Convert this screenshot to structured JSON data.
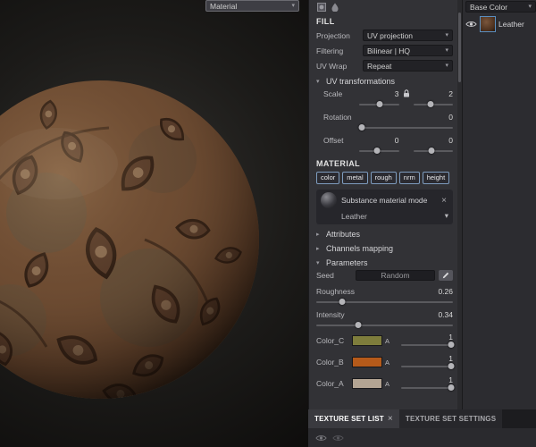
{
  "viewport": {
    "display_mode": "Material"
  },
  "icons": {
    "chevron_down": "▾",
    "chevron_right": "▸",
    "close": "×"
  },
  "fill": {
    "title": "FILL",
    "rows": [
      {
        "label": "Projection",
        "value": "UV projection"
      },
      {
        "label": "Filtering",
        "value": "Bilinear | HQ"
      },
      {
        "label": "UV Wrap",
        "value": "Repeat"
      }
    ],
    "uv": {
      "title": "UV transformations",
      "scale_label": "Scale",
      "scale_x": "3",
      "scale_y": "2",
      "rotation_label": "Rotation",
      "rotation_value": "0",
      "offset_label": "Offset",
      "offset_x": "0",
      "offset_y": "0"
    }
  },
  "material": {
    "title": "MATERIAL",
    "channels": [
      "color",
      "metal",
      "rough",
      "nrm",
      "height"
    ],
    "mode_label": "Substance material mode",
    "name": "Leather",
    "attributes_label": "Attributes",
    "channels_mapping_label": "Channels mapping",
    "parameters_label": "Parameters",
    "params": {
      "seed_label": "Seed",
      "seed_button": "Random",
      "roughness_label": "Roughness",
      "roughness_value": "0.26",
      "intensity_label": "Intensity",
      "intensity_value": "0.34",
      "colors": [
        {
          "label": "Color_C",
          "hex": "#7e7d3c",
          "alpha_label": "A",
          "value": "1"
        },
        {
          "label": "Color_B",
          "hex": "#b55a1a",
          "alpha_label": "A",
          "value": "1"
        },
        {
          "label": "Color_A",
          "hex": "#b3a493",
          "alpha_label": "A",
          "value": "1"
        }
      ]
    }
  },
  "layers": {
    "channel_select": "Base Color",
    "layer_name": "Leather"
  },
  "tabs": {
    "texture_set_list": "TEXTURE SET LIST",
    "texture_set_settings": "TEXTURE SET SETTINGS"
  }
}
